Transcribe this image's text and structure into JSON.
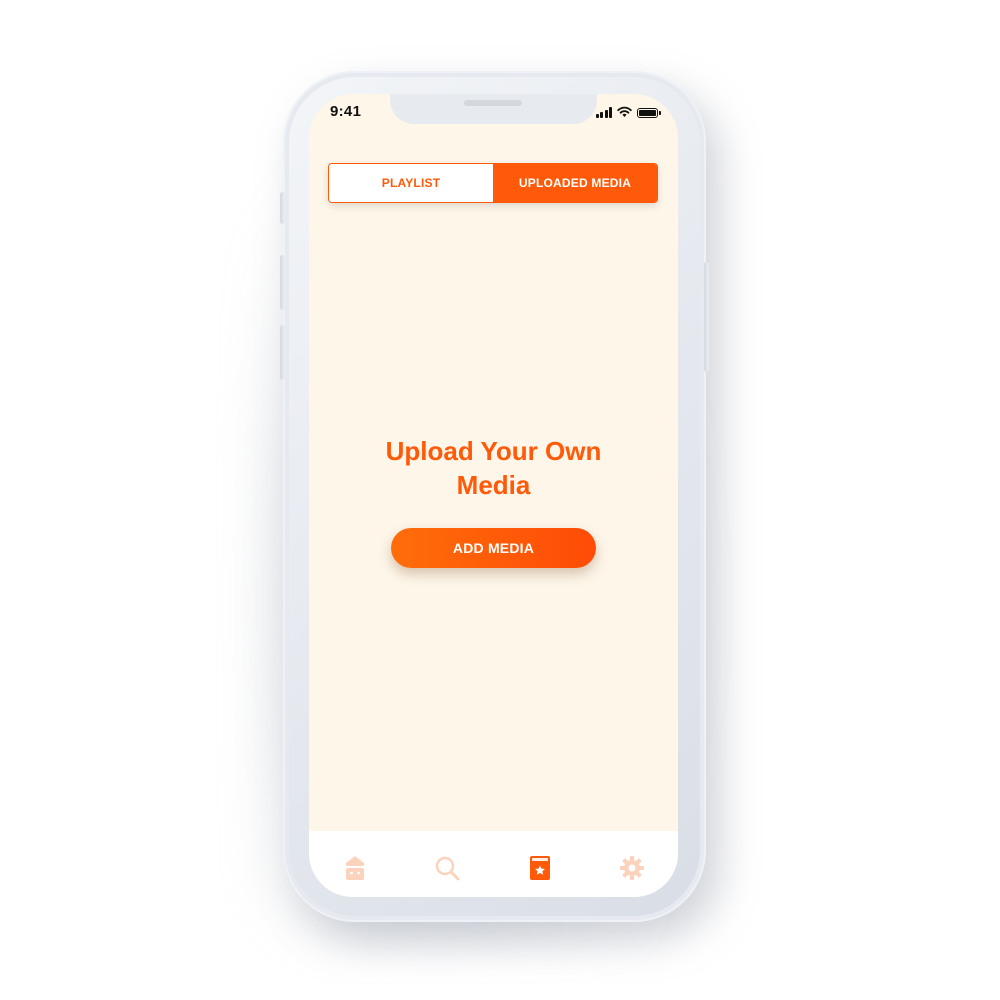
{
  "status_bar": {
    "time": "9:41"
  },
  "tabs": [
    {
      "label": "PLAYLIST",
      "active": false
    },
    {
      "label": "UPLOADED MEDIA",
      "active": true
    }
  ],
  "main": {
    "headline_line1": "Upload Your Own",
    "headline_line2": "Media",
    "add_button_label": "ADD MEDIA"
  },
  "bottom_nav": {
    "items": [
      {
        "icon": "cupcake-icon",
        "active": false
      },
      {
        "icon": "search-icon",
        "active": false
      },
      {
        "icon": "favorites-book-icon",
        "active": true
      },
      {
        "icon": "gear-icon",
        "active": false
      }
    ]
  },
  "colors": {
    "accent": "#ff5a09",
    "screen_background": "#fdf6e9",
    "inactive_icon": "#fbd3bd"
  }
}
